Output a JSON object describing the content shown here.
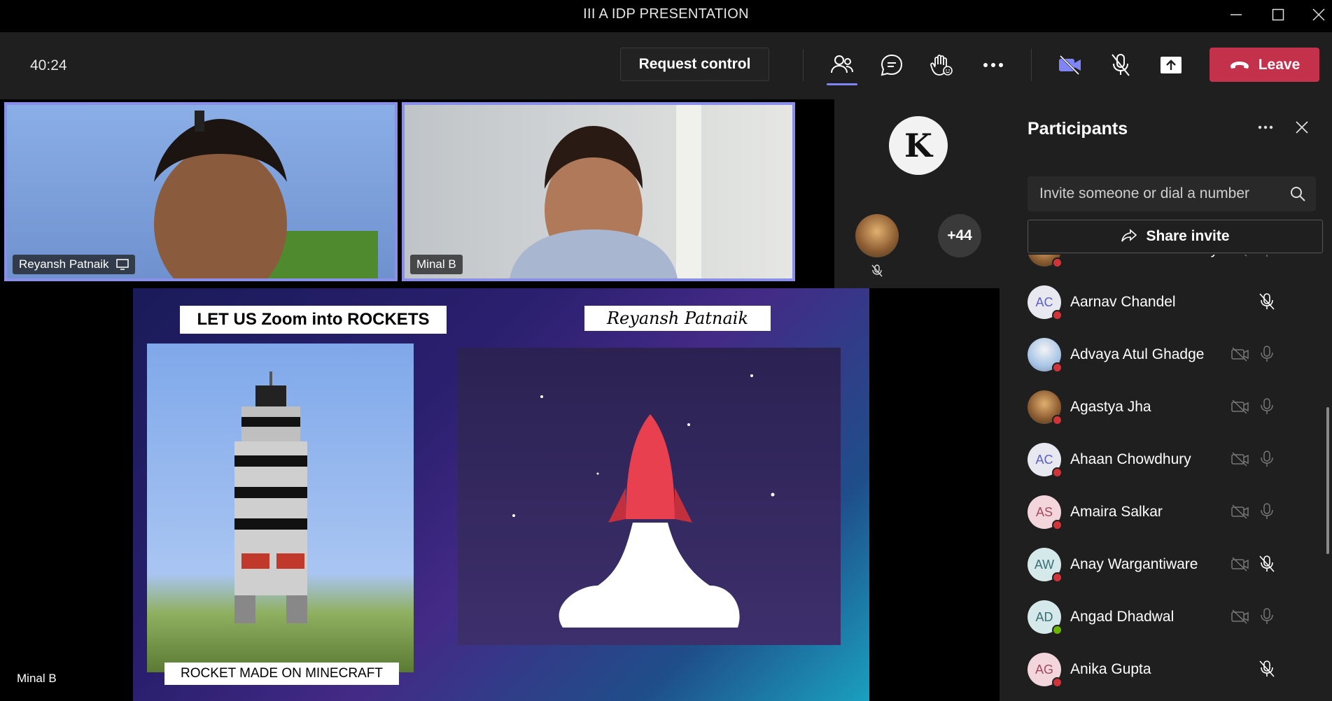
{
  "window": {
    "title": "III A IDP PRESENTATION",
    "controls": [
      "minimize-icon",
      "maximize-icon",
      "close-icon"
    ]
  },
  "toolbar": {
    "timer": "40:24",
    "request_control_label": "Request control",
    "icons": [
      "people-icon",
      "chat-icon",
      "raise-hand-icon",
      "more-icon",
      "camera-off-icon",
      "mic-off-icon",
      "share-tray-icon"
    ],
    "leave_label": "Leave"
  },
  "video_tiles": [
    {
      "name": "Reyansh Patnaik",
      "has_share_icon": true
    },
    {
      "name": "Minal B",
      "has_share_icon": false
    }
  ],
  "overflow": {
    "avatar_letter": "K",
    "more_count": "+44"
  },
  "shared_content": {
    "presenter_name": "Minal B",
    "slide_title": "LET US Zoom into ROCKETS",
    "slide_author": "Reyansh Patnaik",
    "image_caption": "ROCKET MADE ON MINECRAFT"
  },
  "participants_panel": {
    "title": "Participants",
    "search_placeholder": "Invite someone or dial a number",
    "share_invite_label": "Share invite",
    "participants": [
      {
        "name": "Aarnav Ashish Pandey",
        "initials": "",
        "avatar": "photo",
        "status": "busy",
        "mic": "on",
        "cam": true
      },
      {
        "name": "Aarnav Chandel",
        "initials": "AC",
        "avatar": "blue",
        "status": "busy",
        "mic": "muted",
        "cam": false
      },
      {
        "name": "Advaya Atul Ghadge",
        "initials": "",
        "avatar": "photo2",
        "status": "busy",
        "mic": "on",
        "cam": true
      },
      {
        "name": "Agastya Jha",
        "initials": "",
        "avatar": "photo",
        "status": "busy",
        "mic": "on",
        "cam": true
      },
      {
        "name": "Ahaan Chowdhury",
        "initials": "AC",
        "avatar": "blue",
        "status": "busy",
        "mic": "on",
        "cam": true
      },
      {
        "name": "Amaira Salkar",
        "initials": "AS",
        "avatar": "pink",
        "status": "busy",
        "mic": "on",
        "cam": true
      },
      {
        "name": "Anay Wargantiware",
        "initials": "AW",
        "avatar": "teal",
        "status": "busy",
        "mic": "muted",
        "cam": true
      },
      {
        "name": "Angad Dhadwal",
        "initials": "AD",
        "avatar": "teal",
        "status": "available",
        "mic": "on",
        "cam": true
      },
      {
        "name": "Anika Gupta",
        "initials": "AG",
        "avatar": "pink",
        "status": "busy",
        "mic": "muted",
        "cam": false
      }
    ]
  }
}
